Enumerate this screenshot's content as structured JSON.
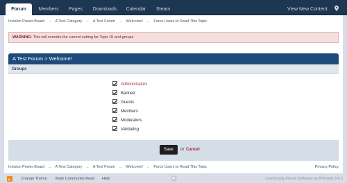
{
  "nav": {
    "tabs": [
      {
        "label": "Forum"
      },
      {
        "label": "Members"
      },
      {
        "label": "Pages"
      },
      {
        "label": "Downloads"
      },
      {
        "label": "Calendar"
      },
      {
        "label": "Steam"
      }
    ],
    "view_new_content": "View New Content",
    "location_icon": "map-pin-icon"
  },
  "breadcrumb": {
    "items": [
      "Invision Power Board",
      "A Test Category",
      "A Test Forum",
      "Welcome!",
      "Force Users to Read This Topic"
    ],
    "separator": "→"
  },
  "warning": {
    "label": "WARNING",
    "text": ": This will override the current setting for Topic ID and groups"
  },
  "form": {
    "title": "A Test Forum > Welcome!",
    "groups_header": "Groups",
    "groups": [
      {
        "label": "Administrators",
        "checked": true
      },
      {
        "label": "Banned",
        "checked": true
      },
      {
        "label": "Guests",
        "checked": true
      },
      {
        "label": "Members",
        "checked": true
      },
      {
        "label": "Moderators",
        "checked": true
      },
      {
        "label": "Validating",
        "checked": true
      }
    ],
    "save_label": "Save",
    "or_text": "or",
    "cancel_label": "Cancel"
  },
  "privacy_label": "Privacy Policy",
  "footer": {
    "change_theme": "Change Theme",
    "mark_read": "Mark Community Read",
    "help": "Help",
    "copyright": "Community Forum Software by IP.Board 3.4.2"
  },
  "colors": {
    "nav_bg": "#1d3652",
    "title_bar": "#1d4a7a",
    "warning_bg": "#f3dfe0",
    "link_red": "#ad2930"
  }
}
